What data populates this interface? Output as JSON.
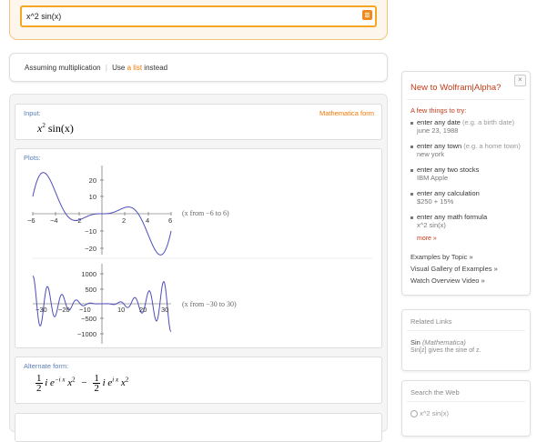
{
  "search": {
    "value": "x^2 sin(x)"
  },
  "assumption": {
    "prefix": "Assuming multiplication",
    "sep": "|",
    "use": "Use",
    "link": "a list",
    "suffix": "instead"
  },
  "pods": {
    "input": {
      "title": "Input:",
      "link": "Mathematica form",
      "expr_base": "x",
      "expr_exp": "2",
      "expr_rest": " sin(x)"
    },
    "plots": {
      "title": "Plots:",
      "plot1": {
        "range_label": "(x from −6 to 6)",
        "xticks": [
          "−6",
          "−4",
          "−2",
          "2",
          "4",
          "6"
        ],
        "yticks": [
          "20",
          "10",
          "−10",
          "−20"
        ]
      },
      "plot2": {
        "range_label": "(x from −30 to 30)",
        "xticks": [
          "−30",
          "−20",
          "−10",
          "10",
          "20",
          "30"
        ],
        "yticks": [
          "1000",
          "500",
          "−500",
          "−1000"
        ]
      }
    },
    "alternate": {
      "title": "Alternate form:",
      "frac_num": "1",
      "frac_den": "2",
      "term1": "i e",
      "term1_exp": "−i x",
      "term1_tail": " x",
      "sq": "2",
      "minus": "−",
      "term2": "i e",
      "term2_exp": "i x",
      "term2_tail": " x"
    }
  },
  "sidebar": {
    "new_title": "New to Wolfram|Alpha?",
    "close": "×",
    "try_heading": "A few things to try:",
    "tips": [
      {
        "label": "enter any date",
        "hint": "(e.g. a birth date)",
        "example": "june 23, 1988"
      },
      {
        "label": "enter any town",
        "hint": "(e.g. a home town)",
        "example": "new york"
      },
      {
        "label": "enter any two stocks",
        "hint": "",
        "example": "IBM Apple"
      },
      {
        "label": "enter any calculation",
        "hint": "",
        "example": "$250 + 15%"
      },
      {
        "label": "enter any math formula",
        "hint": "",
        "example": "x^2 sin(x)"
      }
    ],
    "more": "more »",
    "links": [
      "Examples by Topic »",
      "Visual Gallery of Examples »",
      "Watch Overview Video »"
    ],
    "related_header": "Related Links",
    "related_item": "Sin",
    "related_item_source": "(Mathematica)",
    "related_desc": "Sin[z] gives the sine of z.",
    "web_header": "Search the Web",
    "web_query": "x^2 sin(x)"
  }
}
